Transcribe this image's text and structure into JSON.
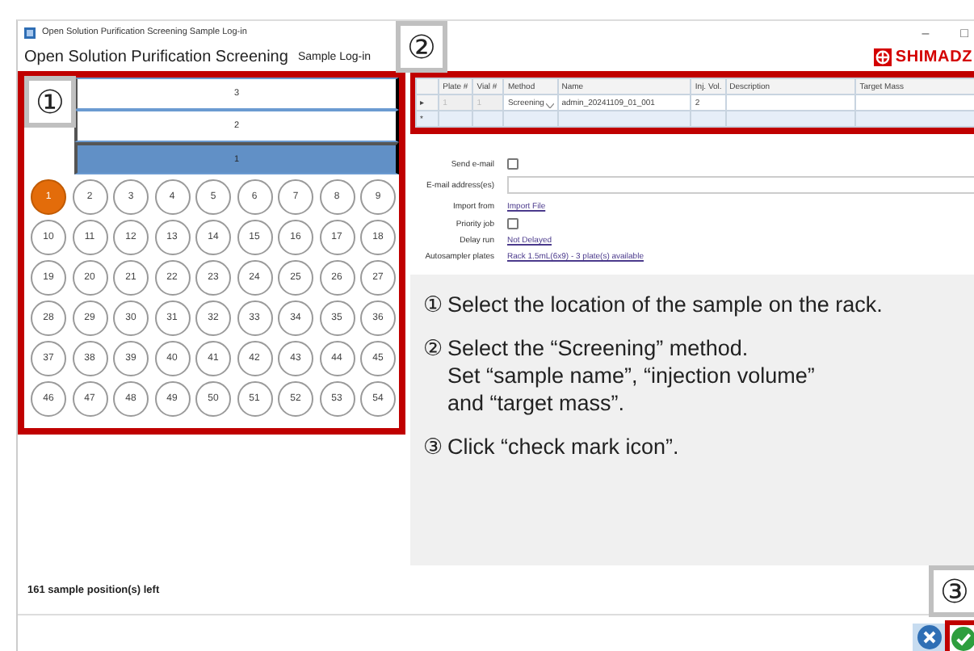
{
  "window": {
    "title": "Open Solution Purification Screening Sample Log-in",
    "controls": [
      "–",
      "□"
    ]
  },
  "app": {
    "title": "Open Solution Purification Screening",
    "subtitle": "Sample Log-in",
    "logo": "SHIMADZ"
  },
  "plates": [
    {
      "label": "3",
      "selected": false
    },
    {
      "label": "2",
      "selected": false
    },
    {
      "label": "1",
      "selected": true
    }
  ],
  "wells": [
    {
      "label": "1",
      "selected": true
    },
    {
      "label": "2",
      "selected": false
    },
    {
      "label": "3",
      "selected": false
    },
    {
      "label": "4",
      "selected": false
    },
    {
      "label": "5",
      "selected": false
    },
    {
      "label": "6",
      "selected": false
    },
    {
      "label": "7",
      "selected": false
    },
    {
      "label": "8",
      "selected": false
    },
    {
      "label": "9",
      "selected": false
    },
    {
      "label": "10",
      "selected": false
    },
    {
      "label": "11",
      "selected": false
    },
    {
      "label": "12",
      "selected": false
    },
    {
      "label": "13",
      "selected": false
    },
    {
      "label": "14",
      "selected": false
    },
    {
      "label": "15",
      "selected": false
    },
    {
      "label": "16",
      "selected": false
    },
    {
      "label": "17",
      "selected": false
    },
    {
      "label": "18",
      "selected": false
    },
    {
      "label": "19",
      "selected": false
    },
    {
      "label": "20",
      "selected": false
    },
    {
      "label": "21",
      "selected": false
    },
    {
      "label": "22",
      "selected": false
    },
    {
      "label": "23",
      "selected": false
    },
    {
      "label": "24",
      "selected": false
    },
    {
      "label": "25",
      "selected": false
    },
    {
      "label": "26",
      "selected": false
    },
    {
      "label": "27",
      "selected": false
    },
    {
      "label": "28",
      "selected": false
    },
    {
      "label": "29",
      "selected": false
    },
    {
      "label": "30",
      "selected": false
    },
    {
      "label": "31",
      "selected": false
    },
    {
      "label": "32",
      "selected": false
    },
    {
      "label": "33",
      "selected": false
    },
    {
      "label": "34",
      "selected": false
    },
    {
      "label": "35",
      "selected": false
    },
    {
      "label": "36",
      "selected": false
    },
    {
      "label": "37",
      "selected": false
    },
    {
      "label": "38",
      "selected": false
    },
    {
      "label": "39",
      "selected": false
    },
    {
      "label": "40",
      "selected": false
    },
    {
      "label": "41",
      "selected": false
    },
    {
      "label": "42",
      "selected": false
    },
    {
      "label": "43",
      "selected": false
    },
    {
      "label": "44",
      "selected": false
    },
    {
      "label": "45",
      "selected": false
    },
    {
      "label": "46",
      "selected": false
    },
    {
      "label": "47",
      "selected": false
    },
    {
      "label": "48",
      "selected": false
    },
    {
      "label": "49",
      "selected": false
    },
    {
      "label": "50",
      "selected": false
    },
    {
      "label": "51",
      "selected": false
    },
    {
      "label": "52",
      "selected": false
    },
    {
      "label": "53",
      "selected": false
    },
    {
      "label": "54",
      "selected": false
    }
  ],
  "table": {
    "columns": [
      "Plate #",
      "Vial #",
      "Method",
      "Name",
      "Inj. Vol.",
      "Description",
      "Target Mass"
    ],
    "rows": [
      {
        "marker": "▸",
        "cells": [
          "1",
          "1",
          "Screening",
          "admin_20241109_01_001",
          "2",
          "",
          ""
        ]
      },
      {
        "marker": "*",
        "cells": [
          "",
          "",
          "",
          "",
          "",
          "",
          ""
        ]
      }
    ]
  },
  "form": [
    {
      "kind": "checkbox",
      "label": "Send e-mail",
      "checked": false
    },
    {
      "kind": "text",
      "label": "E-mail address(es)"
    },
    {
      "kind": "link",
      "label": "Import from",
      "value": "Import File"
    },
    {
      "kind": "checkbox",
      "label": "Priority job",
      "checked": false
    },
    {
      "kind": "link",
      "label": "Delay run",
      "value": "Not Delayed"
    },
    {
      "kind": "link",
      "label": "Autosampler plates",
      "value": "Rack 1.5mL(6x9) - 3 plate(s) available"
    }
  ],
  "instructions": [
    {
      "number": "①",
      "lines": [
        "Select the location of the sample on the rack."
      ]
    },
    {
      "number": "②",
      "lines": [
        "Select the “Screening” method.",
        "Set “sample name”, “injection volume”",
        "and “target mass”."
      ]
    },
    {
      "number": "③",
      "lines": [
        "Click “check mark icon”."
      ]
    }
  ],
  "status": "161 sample position(s) left",
  "callouts": [
    "①",
    "②",
    "③"
  ]
}
